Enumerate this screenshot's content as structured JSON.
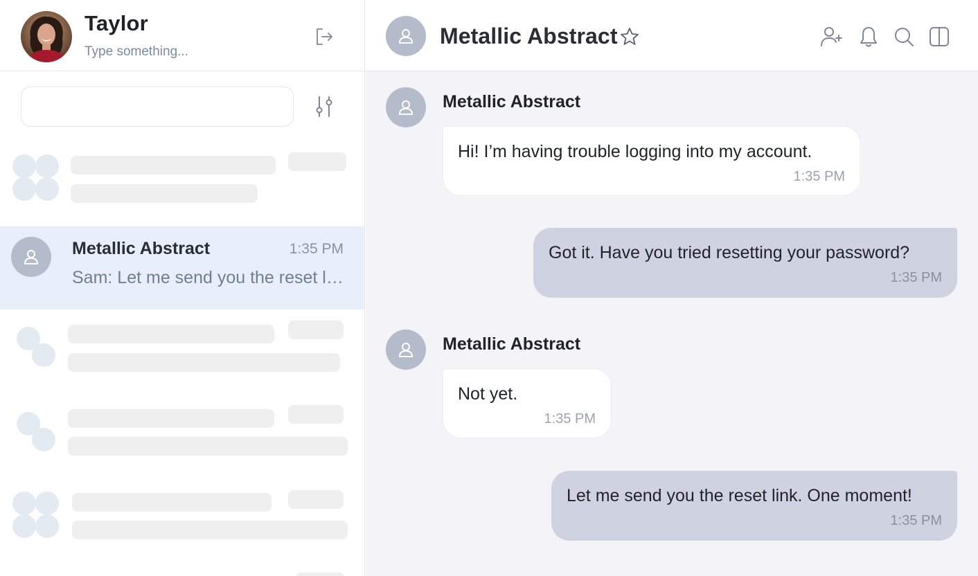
{
  "user": {
    "name": "Taylor",
    "status_placeholder": "Type something..."
  },
  "sidebar": {
    "search": {
      "placeholder": "",
      "value": ""
    },
    "active_conversation": {
      "name": "Metallic Abstract",
      "time": "1:35 PM",
      "preview": "Sam: Let me send you the reset link. One moment!"
    }
  },
  "chat": {
    "title": "Metallic Abstract",
    "messages": [
      {
        "direction": "in",
        "sender": "Metallic Abstract",
        "text": "Hi! I’m having trouble logging into my account.",
        "time": "1:35 PM"
      },
      {
        "direction": "out",
        "sender": "",
        "text": "Got it. Have you tried resetting your password?",
        "time": "1:35 PM"
      },
      {
        "direction": "in",
        "sender": "Metallic Abstract",
        "text": "Not yet.",
        "time": "1:35 PM"
      },
      {
        "direction": "out",
        "sender": "",
        "text": "Let me send you the reset link. One moment!",
        "time": "1:35 PM"
      }
    ]
  },
  "icons": {
    "logout": "logout-icon",
    "filter": "sliders-icon",
    "star": "star-icon",
    "add_user": "add-user-icon",
    "notifications": "bell-icon",
    "search": "search-icon",
    "layout": "split-panel-icon"
  },
  "colors": {
    "active_row": "#e8effa",
    "outgoing_bubble": "#cfd2e0",
    "incoming_bubble": "#ffffff",
    "chat_background": "#f4f4f8",
    "avatar_placeholder": "#b4bccb"
  }
}
